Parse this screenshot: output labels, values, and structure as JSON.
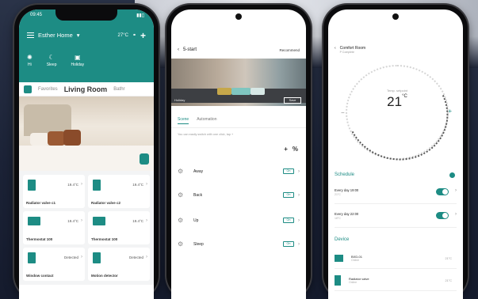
{
  "phone1": {
    "status_time": "09:45",
    "home_name": "Esther Home",
    "home_caret": "▾",
    "home_temp": "27°C",
    "modes": [
      {
        "label": "Hi",
        "icon": "sun-icon"
      },
      {
        "label": "Sleep",
        "icon": "sleep-icon"
      },
      {
        "label": "Holiday",
        "icon": "suitcase-icon"
      }
    ],
    "tabs": [
      "Favorites",
      "Living Room",
      "Bathr"
    ],
    "devices": [
      {
        "name": "Radiator valve c1",
        "value": "19.4°C"
      },
      {
        "name": "Radiator valve c2",
        "value": "19.4°C"
      },
      {
        "name": "Thermostat 100",
        "value": "19.4°C"
      },
      {
        "name": "Thermostat 100",
        "value": "19.4°C"
      },
      {
        "name": "Window contact",
        "value": "Detected"
      },
      {
        "name": "Motion detector",
        "value": "Detected"
      }
    ]
  },
  "phone2": {
    "title": "5-start",
    "right_label": "Recommend",
    "image_label": "Holiday",
    "image_button": "Save",
    "tabs": [
      "Scene",
      "Automation"
    ],
    "hint": "You can easily switch with one click, tap +",
    "add_icon": "+",
    "pct_icon": "%",
    "scenes": [
      {
        "name": "Away",
        "state": "On"
      },
      {
        "name": "Back",
        "state": "On"
      },
      {
        "name": "Up",
        "state": "On"
      },
      {
        "name": "Sleep",
        "state": "On"
      }
    ]
  },
  "phone3": {
    "title": "Comfort Room",
    "subtitle": "P Complete",
    "dial_caption": "Temp. setpoint",
    "setpoint": "21",
    "unit": "°C",
    "minus": "−",
    "plus": "+",
    "schedule_title": "Schedule",
    "schedules": [
      {
        "title": "Every day 19:00",
        "sub": "21°C"
      },
      {
        "title": "Every day 22:00",
        "sub": "18°C"
      }
    ],
    "device_title": "Device",
    "devices": [
      {
        "name": "BXD-01",
        "sub": "Online",
        "level": "21°C"
      },
      {
        "name": "Radiator valve",
        "sub": "Online",
        "level": "21°C"
      }
    ]
  },
  "colors": {
    "accent": "#1d8c84"
  }
}
